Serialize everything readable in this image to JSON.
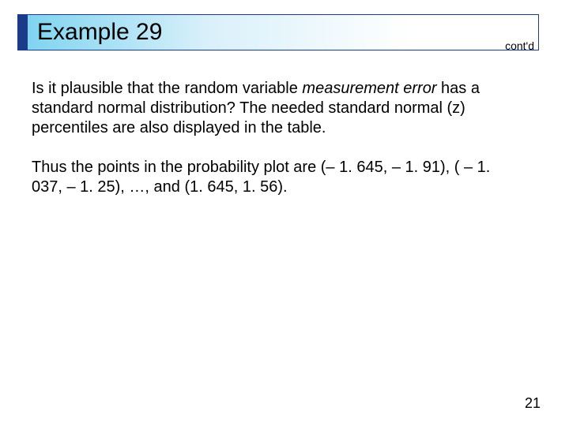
{
  "title": "Example 29",
  "contd": "cont'd",
  "paragraph1_pre": "Is it plausible that the random variable ",
  "paragraph1_italic": "measurement error",
  "paragraph1_post": " has a standard normal distribution? The needed standard normal (z) percentiles are also displayed in the table.",
  "paragraph2": "Thus the points in the probability plot are (– 1. 645, – 1. 91), ( – 1. 037, – 1. 25), …, and (1. 645, 1. 56).",
  "page_number": "21"
}
